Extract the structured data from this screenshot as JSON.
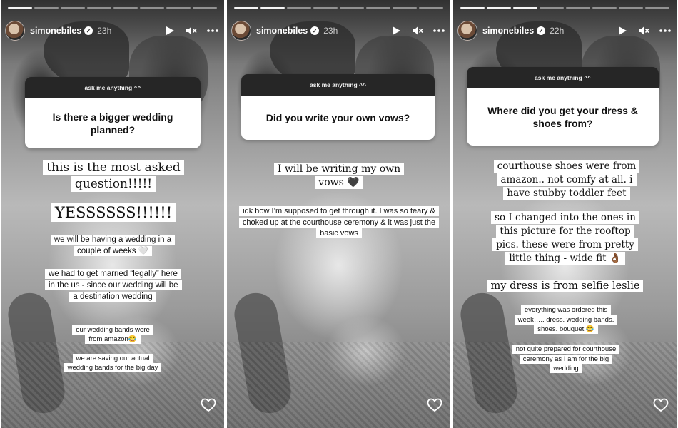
{
  "account": {
    "username": "simonebiles",
    "verified_badge": "verified-badge"
  },
  "stories": [
    {
      "age": "23h",
      "question_header": "ask me anything ^^",
      "question": "Is there a bigger wedding planned?",
      "captions": [
        "this is the most asked question!!!!!",
        "YESSSSSS!!!!!!",
        "we will be having a wedding in a couple of weeks 🤍",
        "we had to get married “legally” here in the us - since our wedding will be a destination wedding",
        "our wedding bands were from amazon😂",
        "we are saving our actual wedding bands for the big day"
      ]
    },
    {
      "age": "23h",
      "question_header": "ask me anything ^^",
      "question": "Did you write your own vows?",
      "captions": [
        "I will be writing my own vows 🖤",
        "idk how I’m supposed to get through it.  I was so teary & choked up at the courthouse ceremony & it was just the basic vows"
      ]
    },
    {
      "age": "22h",
      "question_header": "ask me anything ^^",
      "question": "Where did you get your dress & shoes from?",
      "captions": [
        "courthouse shoes were from amazon.. not comfy at all. i have stubby toddler feet",
        "so I changed into the ones in this picture for the rooftop pics. these were from pretty little thing - wide fit 👌🏾",
        "my dress is from selfie leslie",
        "everything was ordered this week….. dress. wedding bands. shoes. bouquet 😂",
        "not quite prepared for courthouse ceremony as I am for the big wedding"
      ]
    }
  ],
  "icons": {
    "play": "play-icon",
    "mute": "mute-icon",
    "more": "more-icon",
    "like": "heart-icon"
  },
  "colors": {
    "question_header_bg": "#262626",
    "text_box_bg": "#ffffff",
    "text": "#111111"
  }
}
